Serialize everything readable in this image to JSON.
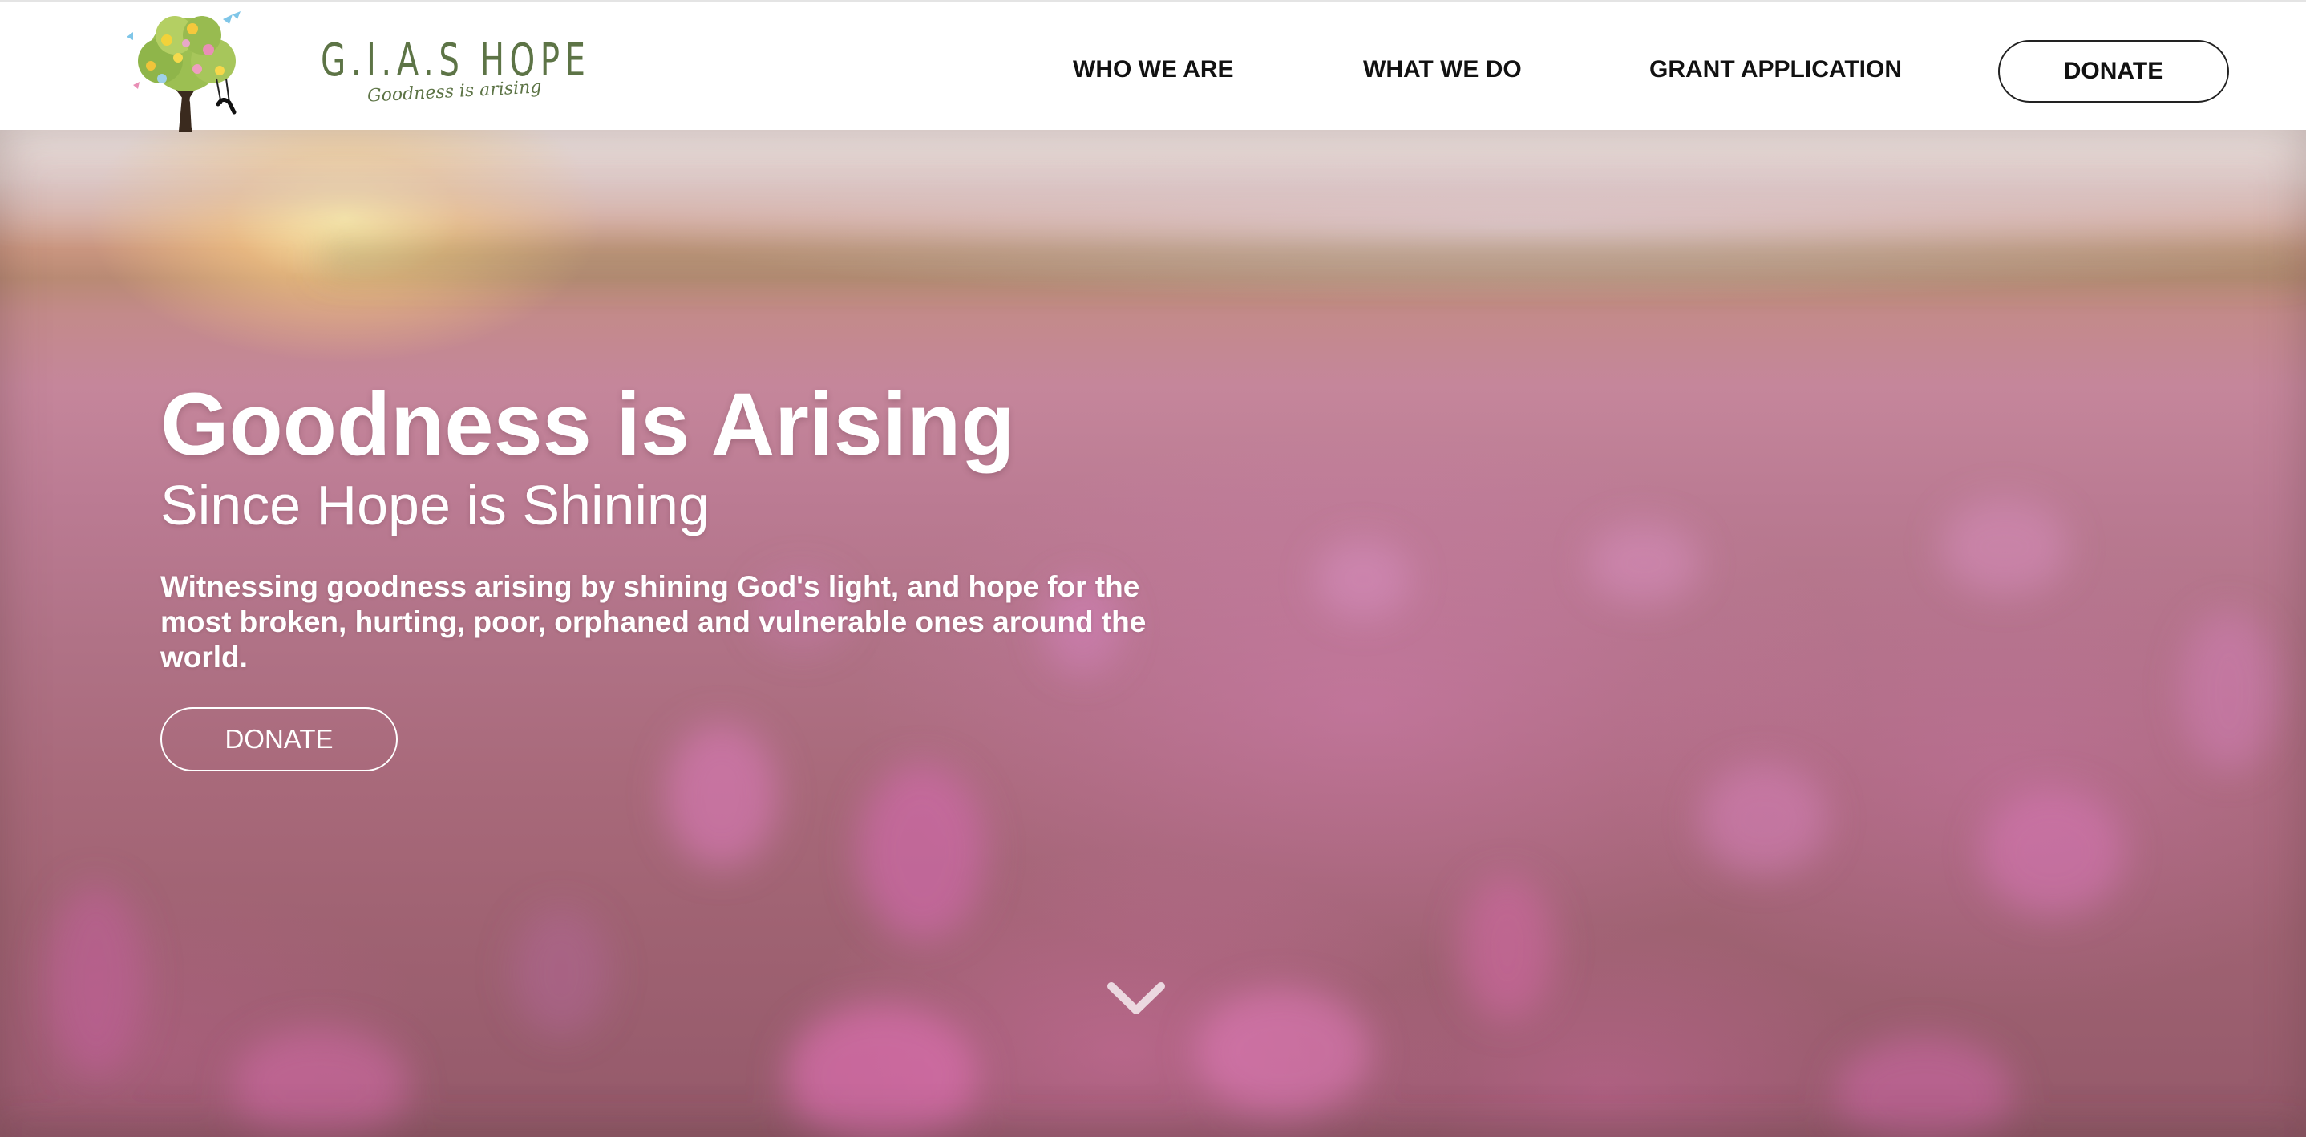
{
  "brand": {
    "name": "G.I.A.S HOPE",
    "tagline": "Goodness is arising",
    "logo_icon": "tree-with-swing-logo-icon"
  },
  "nav": {
    "items": [
      {
        "label": "WHO WE ARE"
      },
      {
        "label": "WHAT WE DO"
      },
      {
        "label": "GRANT APPLICATION"
      }
    ],
    "donate_label": "DONATE"
  },
  "hero": {
    "title": "Goodness is Arising",
    "subtitle": "Since Hope is Shining",
    "description": "Witnessing goodness arising by shining God's light, and hope for the most broken, hurting, poor, orphaned and vulnerable ones around the world.",
    "donate_label": "DONATE",
    "scroll_icon": "chevron-down-icon"
  },
  "colors": {
    "brand_green": "#5d7446",
    "nav_text": "#111111",
    "hero_text": "#ffffff",
    "hero_field_pink": "#c5869b"
  }
}
